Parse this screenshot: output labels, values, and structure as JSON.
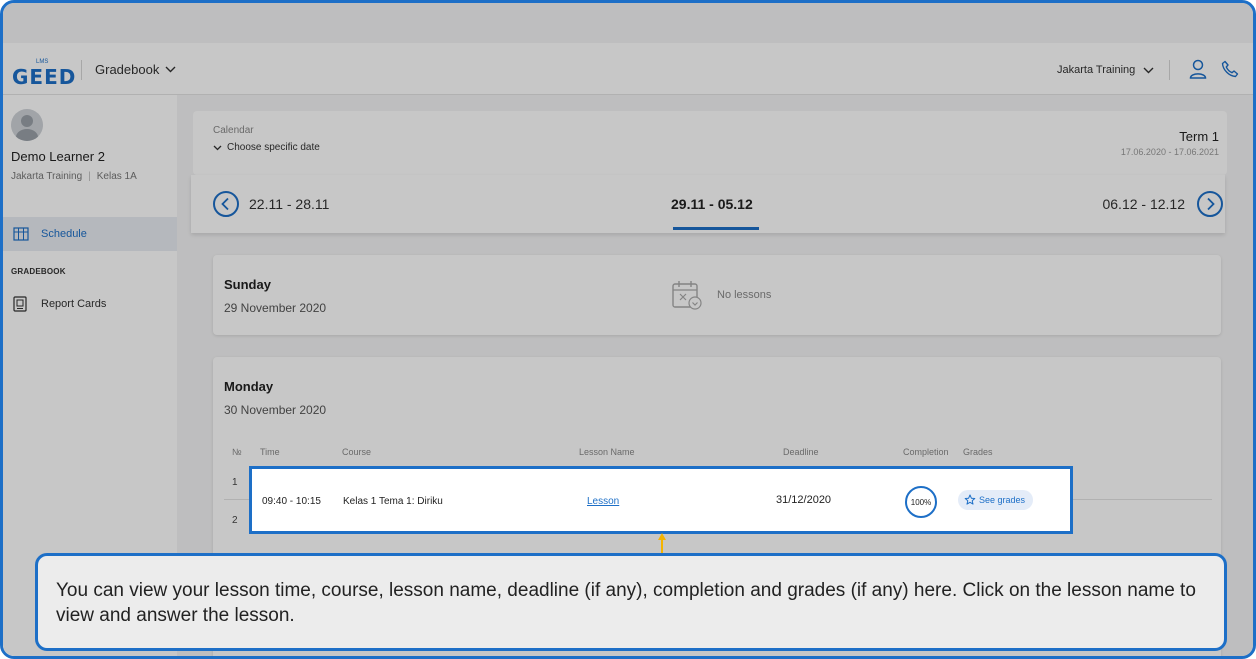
{
  "topbar": {
    "logo_small": "LMS",
    "logo_text": "GEED",
    "module": "Gradebook",
    "organization": "Jakarta Training"
  },
  "sidebar": {
    "learner_name": "Demo Learner 2",
    "school": "Jakarta Training",
    "class": "Kelas 1A",
    "nav_schedule": "Schedule",
    "nav_heading": "GRADEBOOK",
    "nav_report_cards": "Report Cards"
  },
  "calendar": {
    "label": "Calendar",
    "choose": "Choose specific date",
    "term_title": "Term 1",
    "term_range": "17.06.2020 - 17.06.2021"
  },
  "weeks": {
    "prev": "22.11 - 28.11",
    "current": "29.11 - 05.12",
    "next": "06.12 - 12.12"
  },
  "days": {
    "sunday": {
      "title": "Sunday",
      "date": "29 November 2020",
      "empty_text": "No lessons"
    },
    "monday": {
      "title": "Monday",
      "date": "30 November 2020",
      "columns": {
        "no": "№",
        "time": "Time",
        "course": "Course",
        "lesson": "Lesson Name",
        "deadline": "Deadline",
        "completion": "Completion",
        "grades": "Grades"
      },
      "row_numbers": [
        "1",
        "2"
      ],
      "lesson": {
        "time": "09:40 - 10:15",
        "course": "Kelas 1 Tema 1: Diriku",
        "lesson_name": "Lesson",
        "deadline": "31/12/2020",
        "completion": "100%",
        "grades_button": "See grades"
      }
    }
  },
  "callout": {
    "text": "You can view your lesson time, course, lesson name, deadline (if any), completion and grades (if any) here. Click on the lesson name to view and answer the lesson."
  },
  "colors": {
    "accent": "#1d6fc7",
    "pointer": "#f5b400"
  }
}
